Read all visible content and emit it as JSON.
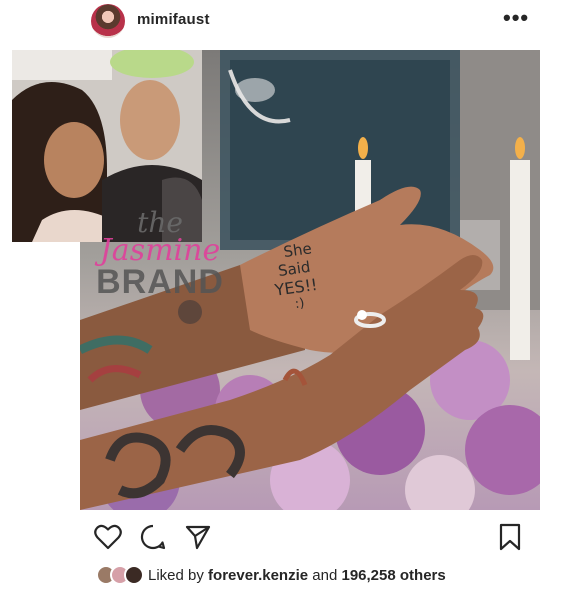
{
  "post": {
    "username": "mimifaust",
    "more_label": "•••"
  },
  "watermark": {
    "line1": "the",
    "line2": "Jasmine",
    "line3": "BRAND"
  },
  "palm_writing": [
    "She",
    "Said",
    "YES!!",
    ":)"
  ],
  "likes": {
    "prefix": "Liked by",
    "user": "forever.kenzie",
    "middle": "and",
    "count": "196,258 others"
  },
  "icons": {
    "like": "heart-icon",
    "comment": "comment-icon",
    "share": "share-icon",
    "save": "bookmark-icon",
    "more": "more-icon"
  }
}
